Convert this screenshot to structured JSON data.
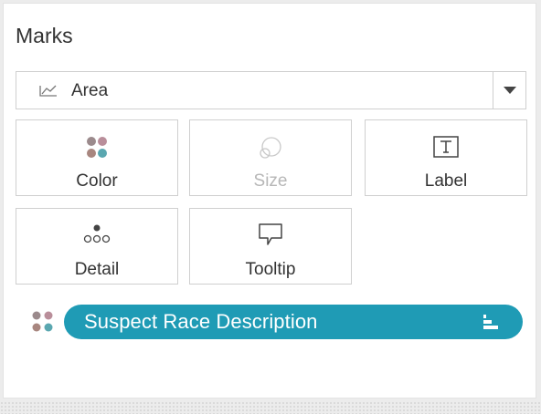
{
  "title": "Marks",
  "mark_type": {
    "selected": "Area",
    "icon": "area-chart-icon"
  },
  "cards": [
    {
      "label": "Color",
      "icon": "color-dots-icon",
      "enabled": true
    },
    {
      "label": "Size",
      "icon": "size-circles-icon",
      "enabled": false
    },
    {
      "label": "Label",
      "icon": "text-t-icon",
      "enabled": true
    },
    {
      "label": "Detail",
      "icon": "detail-dots-icon",
      "enabled": true
    },
    {
      "label": "Tooltip",
      "icon": "speech-bubble-icon",
      "enabled": true
    }
  ],
  "field_pill": {
    "label": "Suspect Race Description",
    "role_icon": "color-dots-icon",
    "sort_icon": "sort-descending-icon",
    "color": "#1f9bb5"
  },
  "colors": {
    "dot_brown": "#a8867f",
    "dot_mauve": "#b98e9a",
    "dot_gray": "#9b8a8c",
    "dot_teal": "#5aa7b0"
  }
}
